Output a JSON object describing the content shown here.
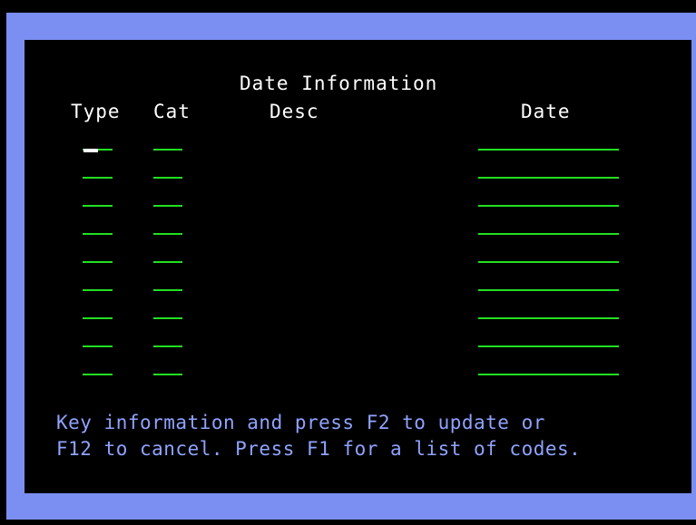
{
  "screen": {
    "title": "Date Information",
    "columns": {
      "type": "Type",
      "cat": "Cat",
      "desc": "Desc",
      "date": "Date"
    },
    "entries": [
      {
        "type": "",
        "cat": "",
        "desc": "",
        "date": ""
      },
      {
        "type": "",
        "cat": "",
        "desc": "",
        "date": ""
      },
      {
        "type": "",
        "cat": "",
        "desc": "",
        "date": ""
      },
      {
        "type": "",
        "cat": "",
        "desc": "",
        "date": ""
      },
      {
        "type": "",
        "cat": "",
        "desc": "",
        "date": ""
      },
      {
        "type": "",
        "cat": "",
        "desc": "",
        "date": ""
      },
      {
        "type": "",
        "cat": "",
        "desc": "",
        "date": ""
      },
      {
        "type": "",
        "cat": "",
        "desc": "",
        "date": ""
      },
      {
        "type": "",
        "cat": "",
        "desc": "",
        "date": ""
      }
    ],
    "instructions": {
      "line1": "Key information and press F2 to update or",
      "line2": "F12 to cancel. Press F1 for a list of codes."
    }
  },
  "colors": {
    "frame": "#7b8ff2",
    "screen_background": "#000000",
    "field_underline": "#22e022",
    "label_text": "#ffffff",
    "instruction_text": "#8fa3ff"
  }
}
